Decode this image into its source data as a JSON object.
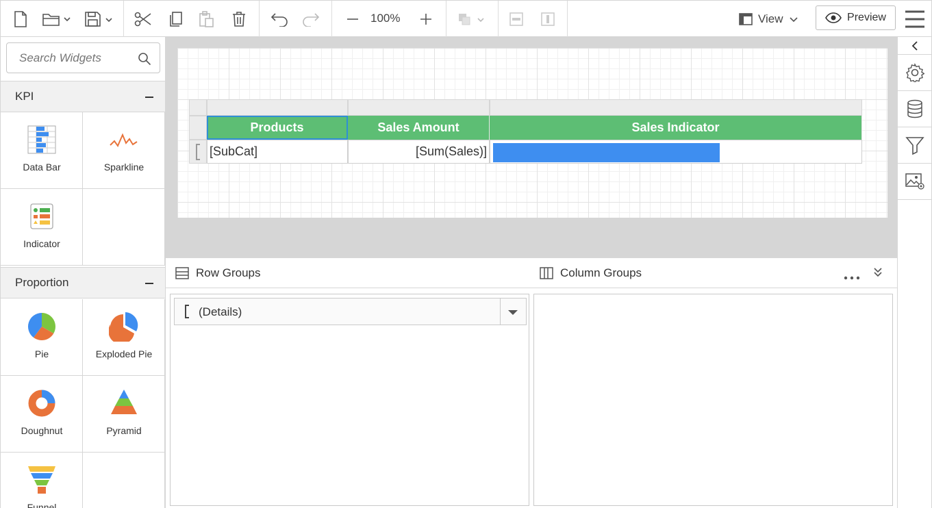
{
  "toolbar": {
    "zoom": "100%",
    "view_label": "View",
    "preview_label": "Preview"
  },
  "left_panel": {
    "search_placeholder": "Search Widgets",
    "categories": [
      {
        "name": "KPI",
        "widgets": [
          "Data Bar",
          "Sparkline",
          "Indicator"
        ]
      },
      {
        "name": "Proportion",
        "widgets": [
          "Pie",
          "Exploded Pie",
          "Doughnut",
          "Pyramid",
          "Funnel"
        ]
      }
    ]
  },
  "table": {
    "headers": [
      "Products",
      "Sales Amount",
      "Sales Indicator"
    ],
    "row": [
      "[SubCat]",
      "[Sum(Sales)]"
    ],
    "data_bar_fraction": 0.62,
    "header_color": "#5dbe74",
    "bar_color": "#3e8ef0"
  },
  "grouping": {
    "row_groups_label": "Row Groups",
    "column_groups_label": "Column Groups",
    "details_label": "(Details)"
  },
  "right_panel": {
    "icons": [
      "collapse-icon",
      "settings-icon",
      "database-icon",
      "filter-icon",
      "image-settings-icon"
    ]
  }
}
